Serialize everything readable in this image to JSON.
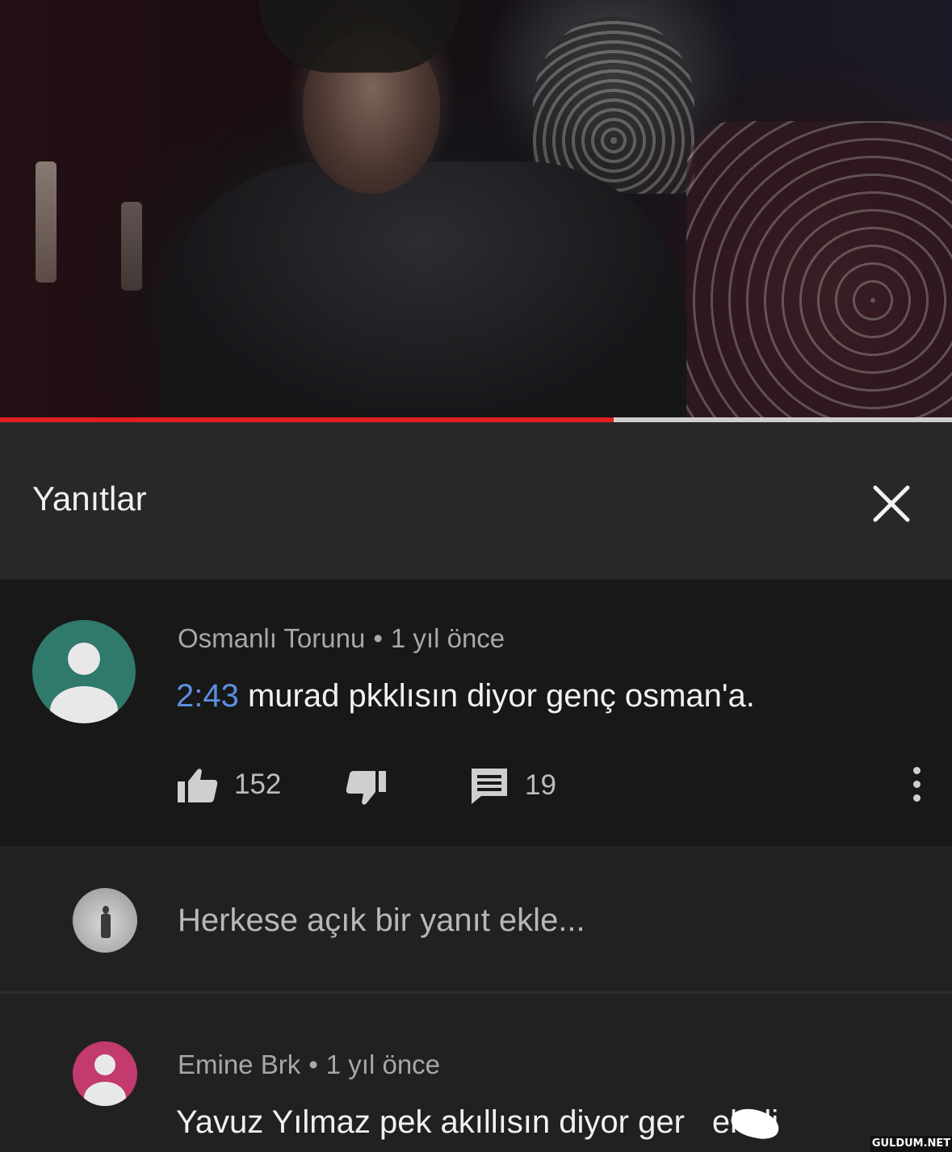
{
  "video": {
    "progress_fraction": 0.645
  },
  "header": {
    "title": "Yanıtlar",
    "close_icon": "close-icon"
  },
  "comment": {
    "author": "Osmanlı Torunu",
    "separator": "•",
    "time": "1 yıl önce",
    "timestamp_link": "2:43",
    "text": " murad pkklısın diyor genç osman'a.",
    "likes": "152",
    "replies": "19",
    "icons": [
      "like-icon",
      "dislike-icon",
      "reply-icon",
      "more-vert-icon"
    ],
    "avatar_color": "#2f7a6a"
  },
  "reply_box": {
    "placeholder": "Herkese açık bir yanıt ekle..."
  },
  "reply": {
    "author": "Emine Brk",
    "separator": "•",
    "time": "1 yıl önce",
    "text": "Yavuz Yılmaz pek akıllısın diyor ger",
    "text_tail": "ekali",
    "avatar_color": "#c23a6e"
  },
  "colors": {
    "progress": "#e01f1f",
    "link": "#5b8fe0",
    "background": "#212121"
  },
  "watermark": "GULDUM.NET"
}
